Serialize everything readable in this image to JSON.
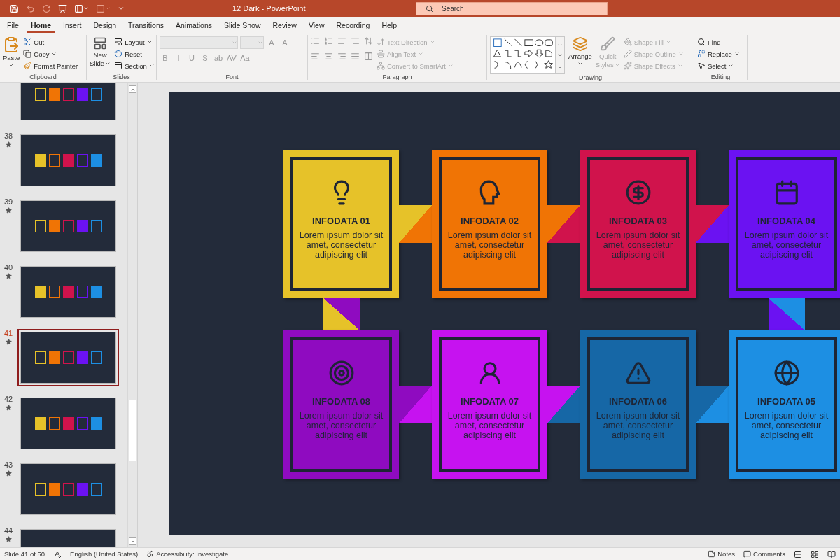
{
  "title_bar": {
    "document": "12 Dark  -  PowerPoint",
    "search": {
      "placeholder": "Search"
    }
  },
  "tabs": [
    {
      "label": "File",
      "selected": false
    },
    {
      "label": "Home",
      "selected": true
    },
    {
      "label": "Insert",
      "selected": false
    },
    {
      "label": "Design",
      "selected": false
    },
    {
      "label": "Transitions",
      "selected": false
    },
    {
      "label": "Animations",
      "selected": false
    },
    {
      "label": "Slide Show",
      "selected": false
    },
    {
      "label": "Review",
      "selected": false
    },
    {
      "label": "View",
      "selected": false
    },
    {
      "label": "Recording",
      "selected": false
    },
    {
      "label": "Help",
      "selected": false
    }
  ],
  "ribbon": {
    "clipboard": {
      "label": "Clipboard",
      "paste": "Paste",
      "cut": "Cut",
      "copy": "Copy",
      "format_painter": "Format Painter"
    },
    "slides": {
      "label": "Slides",
      "new_slide": [
        "New",
        "Slide"
      ],
      "layout": "Layout",
      "reset": "Reset",
      "section": "Section"
    },
    "font": {
      "label": "Font",
      "size_buttons": [
        "A",
        "A"
      ],
      "buttons": [
        "B",
        "I",
        "U",
        "S",
        "ab",
        "AV",
        "Aa"
      ]
    },
    "paragraph": {
      "label": "Paragraph",
      "items": [
        {
          "label": "Text Direction",
          "disabled": true
        },
        {
          "label": "Align Text",
          "disabled": true
        },
        {
          "label": "Convert to SmartArt",
          "disabled": true
        }
      ]
    },
    "drawing": {
      "label": "Drawing",
      "arrange": "Arrange",
      "quick_styles": {
        "label": [
          "Quick",
          "Styles"
        ],
        "disabled": true
      },
      "items": [
        {
          "label": "Shape Fill",
          "disabled": true
        },
        {
          "label": "Shape Outline",
          "disabled": true
        },
        {
          "label": "Shape Effects",
          "disabled": true
        }
      ]
    },
    "editing": {
      "label": "Editing",
      "find": "Find",
      "replace": "Replace",
      "select": "Select"
    }
  },
  "thumbnails": [
    {
      "selected": false
    },
    {
      "number": "38",
      "selected": false
    },
    {
      "number": "39",
      "selected": false
    },
    {
      "number": "40",
      "selected": false
    },
    {
      "number": "41",
      "selected": true
    },
    {
      "number": "42",
      "selected": false
    },
    {
      "number": "43",
      "selected": false
    },
    {
      "number": "44",
      "selected": false
    }
  ],
  "slide": {
    "rows": [
      [
        {
          "title": "INFODATA 01",
          "text": "Lorem ipsum dolor sit amet, consectetur adipiscing elit",
          "color": "#e6c229"
        },
        {
          "title": "INFODATA 02",
          "text": "Lorem ipsum dolor sit amet, consectetur adipiscing elit",
          "color": "#f07405"
        },
        {
          "title": "INFODATA 03",
          "text": "Lorem ipsum dolor sit amet, consectetur adipiscing elit",
          "color": "#d0134c"
        },
        {
          "title": "INFODATA 04",
          "text": "Lorem ipsum dolor sit amet, consectetur adipiscing elit",
          "color": "#6b12f2"
        }
      ],
      [
        {
          "title": "INFODATA 08",
          "text": "Lorem ipsum dolor sit amet, consectetur adipiscing elit",
          "color": "#8f0bc0"
        },
        {
          "title": "INFODATA 07",
          "text": "Lorem ipsum dolor sit amet, consectetur adipiscing elit",
          "color": "#c612f0"
        },
        {
          "title": "INFODATA 06",
          "text": "Lorem ipsum dolor sit amet, consectetur adipiscing elit",
          "color": "#1667a6"
        },
        {
          "title": "INFODATA 05",
          "text": "Lorem ipsum dolor sit amet, consectetur adipiscing elit",
          "color": "#1d8fe3"
        }
      ]
    ]
  },
  "status_bar": {
    "slide": "Slide 41 of 50",
    "language": "English (United States)",
    "accessibility": "Accessibility: Investigate",
    "notes": "Notes",
    "comments": "Comments"
  }
}
